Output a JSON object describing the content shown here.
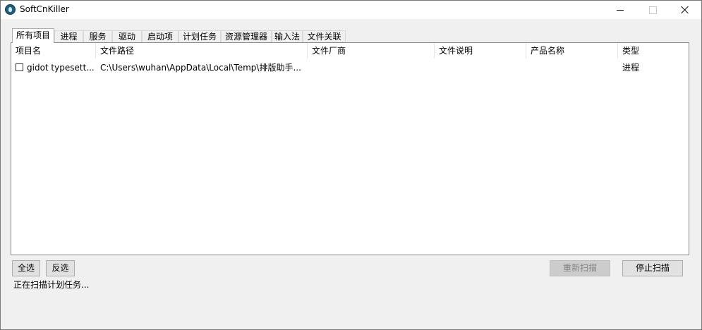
{
  "window": {
    "title": "SoftCnKiller",
    "app_icon": "app-logo-icon"
  },
  "tabs": [
    {
      "label": "所有项目",
      "active": true
    },
    {
      "label": "进程"
    },
    {
      "label": "服务"
    },
    {
      "label": "驱动"
    },
    {
      "label": "启动项"
    },
    {
      "label": "计划任务"
    },
    {
      "label": "资源管理器"
    },
    {
      "label": "输入法"
    },
    {
      "label": "文件关联"
    }
  ],
  "list": {
    "columns": [
      "项目名",
      "文件路径",
      "文件厂商",
      "文件说明",
      "产品名称",
      "类型"
    ],
    "rows": [
      {
        "checked": false,
        "name": "gidot typesett...",
        "path": "C:\\Users\\wuhan\\AppData\\Local\\Temp\\排版助手...",
        "vendor": "",
        "description": "",
        "product": "",
        "type": "进程"
      }
    ]
  },
  "buttons": {
    "select_all": "全选",
    "invert": "反选",
    "rescan": "重新扫描",
    "stop_scan": "停止扫描"
  },
  "status": "正在扫描计划任务...",
  "colors": {
    "active_tab_bg": "#ffffff",
    "window_bg": "#f0f0f0",
    "disabled_text": "#838383"
  }
}
